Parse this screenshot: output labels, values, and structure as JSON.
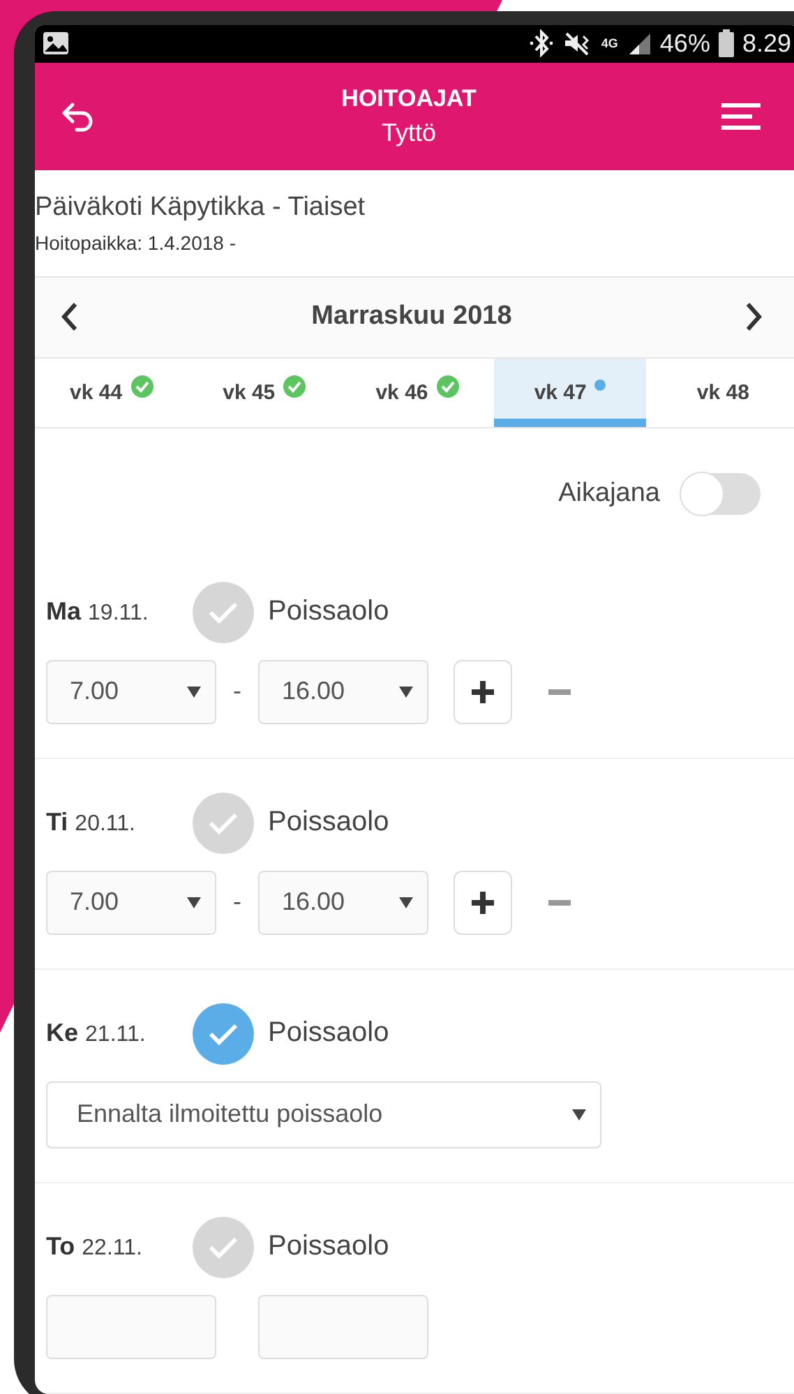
{
  "status_bar": {
    "network": "4G",
    "battery": "46%",
    "time": "8.29"
  },
  "header": {
    "title": "HOITOAJAT",
    "subtitle": "Tyttö"
  },
  "facility": {
    "name": "Päiväkoti Käpytikka - Tiaiset",
    "period": "Hoitopaikka: 1.4.2018 -"
  },
  "month": {
    "label": "Marraskuu 2018"
  },
  "weeks": [
    {
      "label": "vk 44",
      "kind": "complete",
      "selected": false
    },
    {
      "label": "vk 45",
      "kind": "complete",
      "selected": false
    },
    {
      "label": "vk 46",
      "kind": "complete",
      "selected": false
    },
    {
      "label": "vk 47",
      "kind": "pending",
      "selected": true
    },
    {
      "label": "vk 48",
      "kind": "plain",
      "selected": false
    }
  ],
  "timeline": {
    "label": "Aikajana",
    "on": false
  },
  "days": [
    {
      "kind": "times",
      "weekday": "Ma",
      "date": "19.11.",
      "absence_label": "Poissaolo",
      "checked": false,
      "start": "7.00",
      "separator": "-",
      "end": "16.00"
    },
    {
      "kind": "times",
      "weekday": "Ti",
      "date": "20.11.",
      "absence_label": "Poissaolo",
      "checked": false,
      "start": "7.00",
      "separator": "-",
      "end": "16.00"
    },
    {
      "kind": "reason",
      "weekday": "Ke",
      "date": "21.11.",
      "absence_label": "Poissaolo",
      "checked": true,
      "reason": "Ennalta ilmoitettu poissaolo"
    },
    {
      "kind": "partial",
      "weekday": "To",
      "date": "22.11.",
      "absence_label": "Poissaolo",
      "checked": false
    }
  ]
}
